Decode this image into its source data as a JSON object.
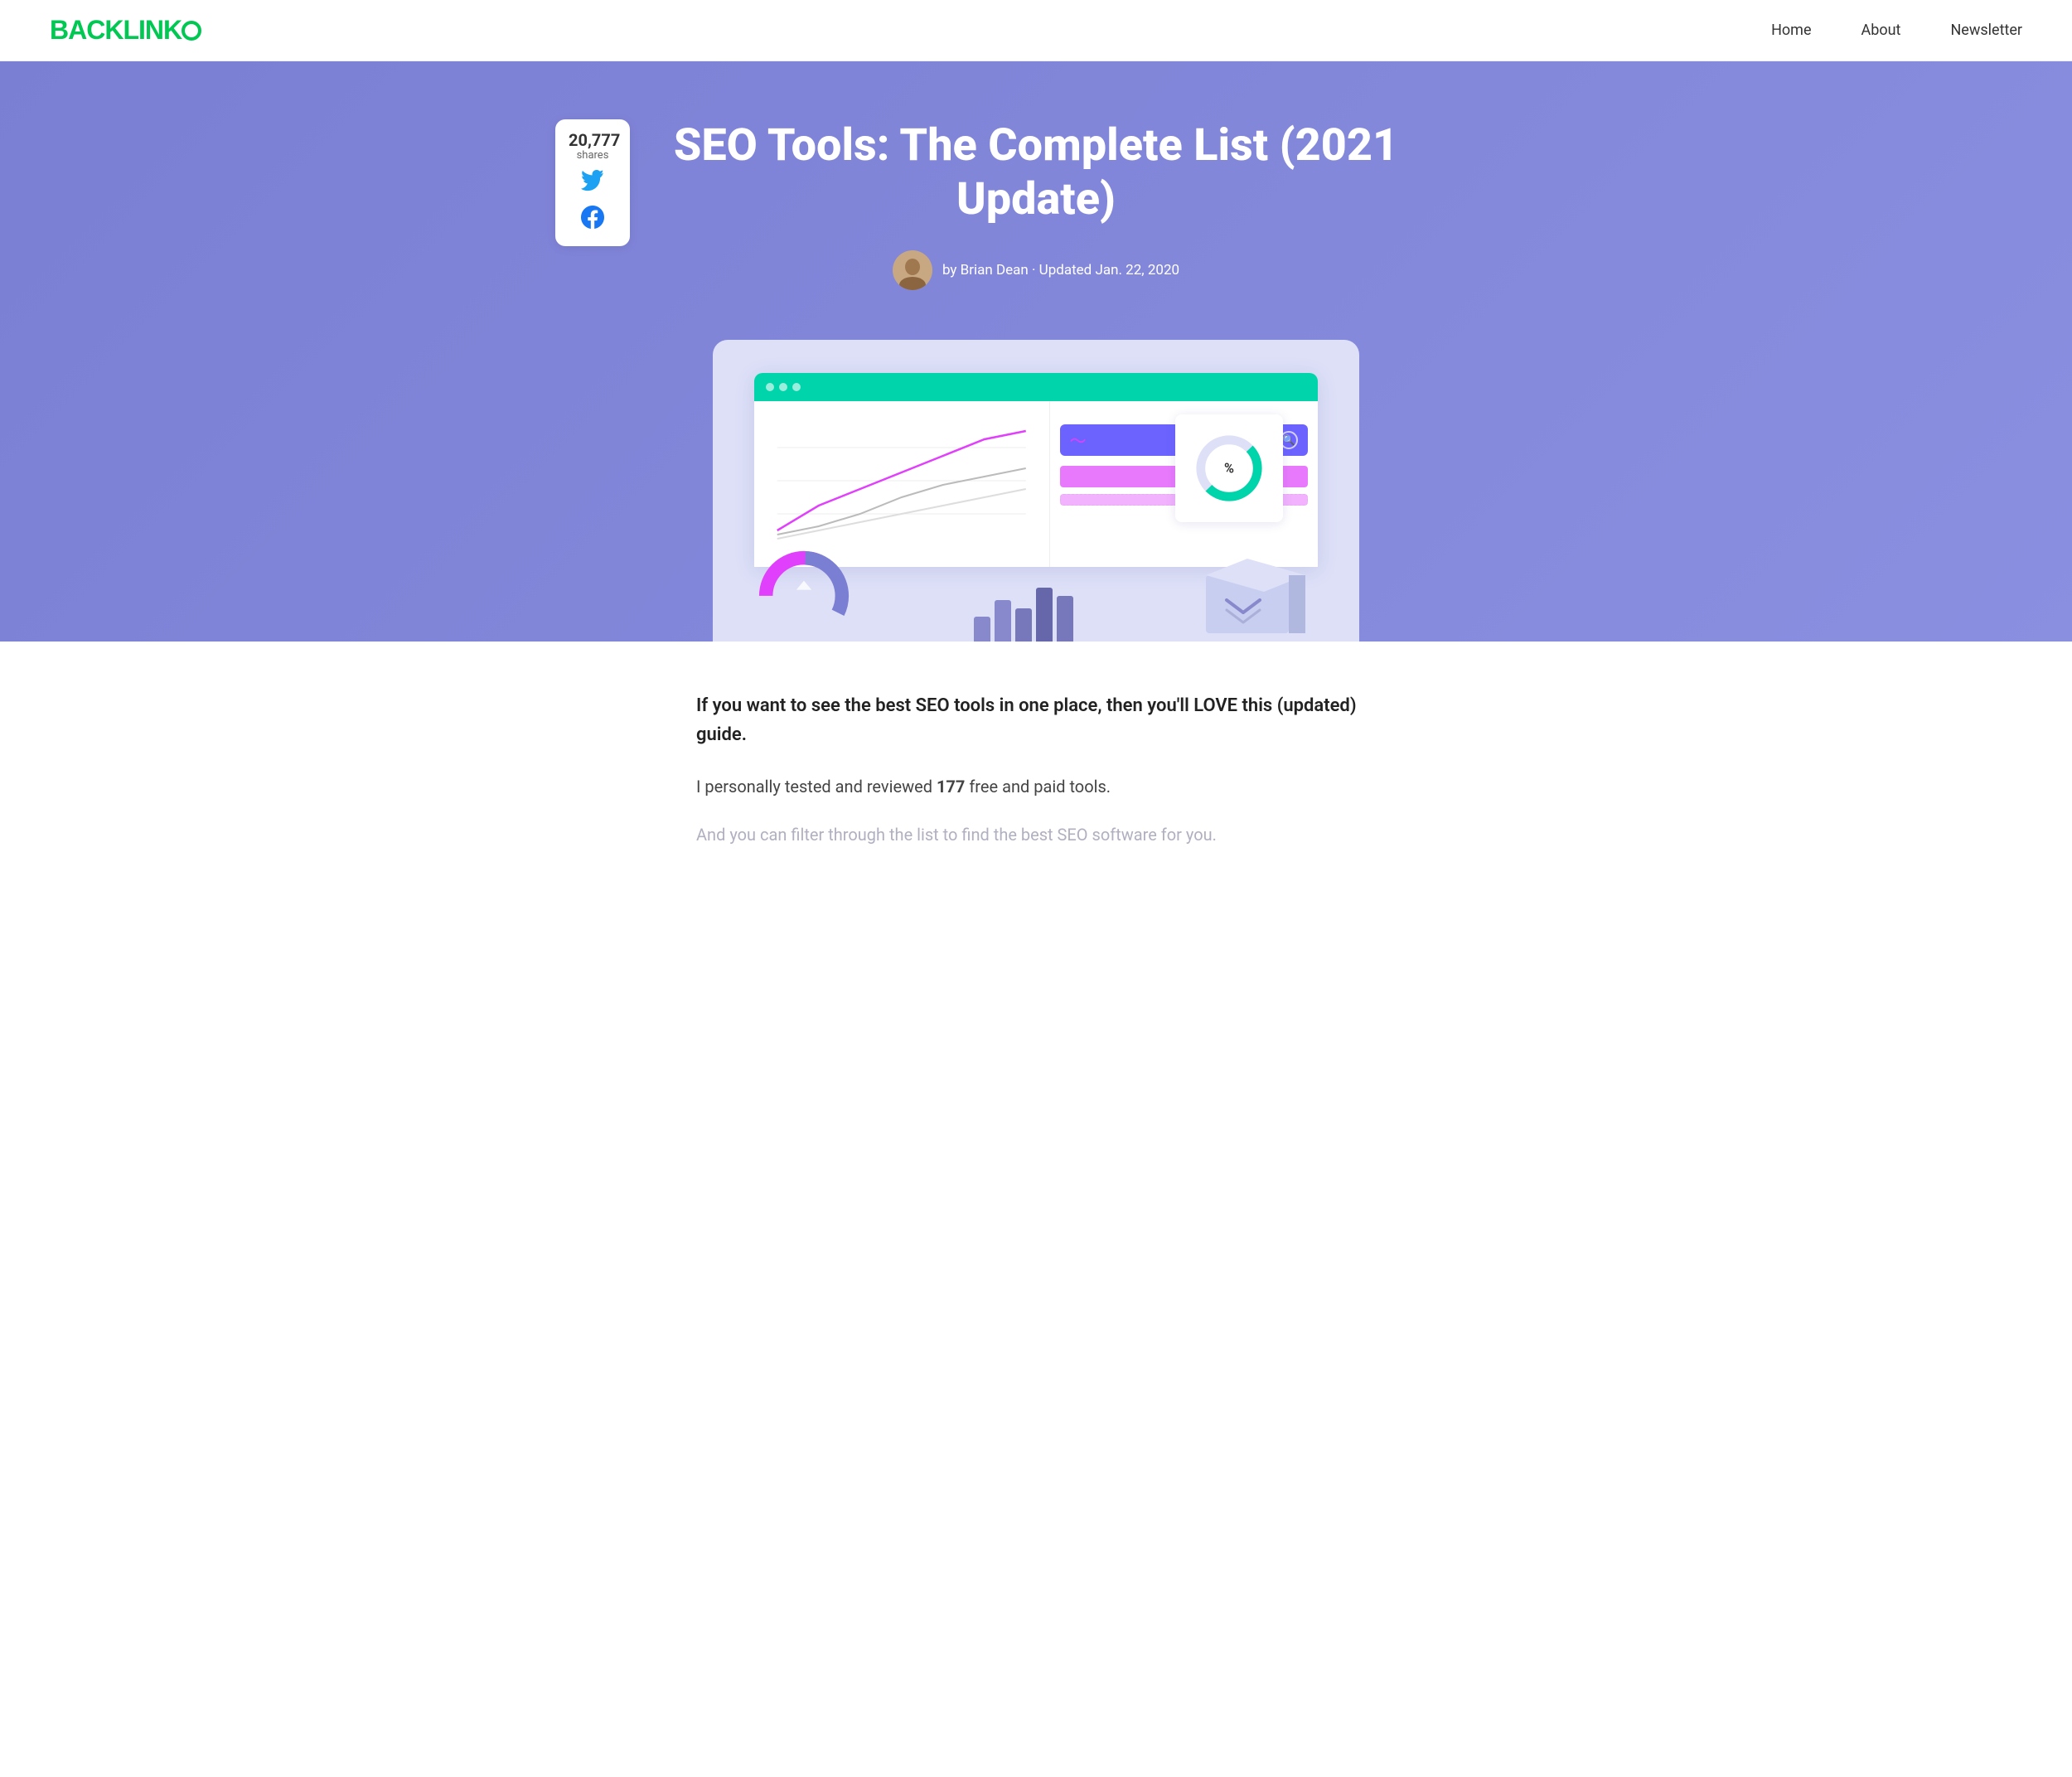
{
  "nav": {
    "logo_text": "BACKLINK",
    "logo_o": "O",
    "links": [
      {
        "label": "Home",
        "href": "#"
      },
      {
        "label": "About",
        "href": "#"
      },
      {
        "label": "Newsletter",
        "href": "#"
      }
    ]
  },
  "hero": {
    "title": "SEO Tools: The Complete List (2021 Update)",
    "author_name": "Brian Dean",
    "updated_text": "by Brian Dean · Updated Jan. 22, 2020"
  },
  "share": {
    "count": "20,777",
    "label": "shares"
  },
  "content": {
    "intro_bold": "If you want to see the best SEO tools in one place, then you'll LOVE this (updated) guide.",
    "intro_normal_prefix": "I personally tested and reviewed ",
    "intro_number": "177",
    "intro_normal_suffix": " free and paid tools.",
    "intro_faded": "And you can filter through the list to find the best SEO software for you."
  },
  "colors": {
    "brand_green": "#00c853",
    "hero_bg": "#7b7fd4",
    "twitter_blue": "#1da1f2",
    "facebook_blue": "#1877f2"
  }
}
